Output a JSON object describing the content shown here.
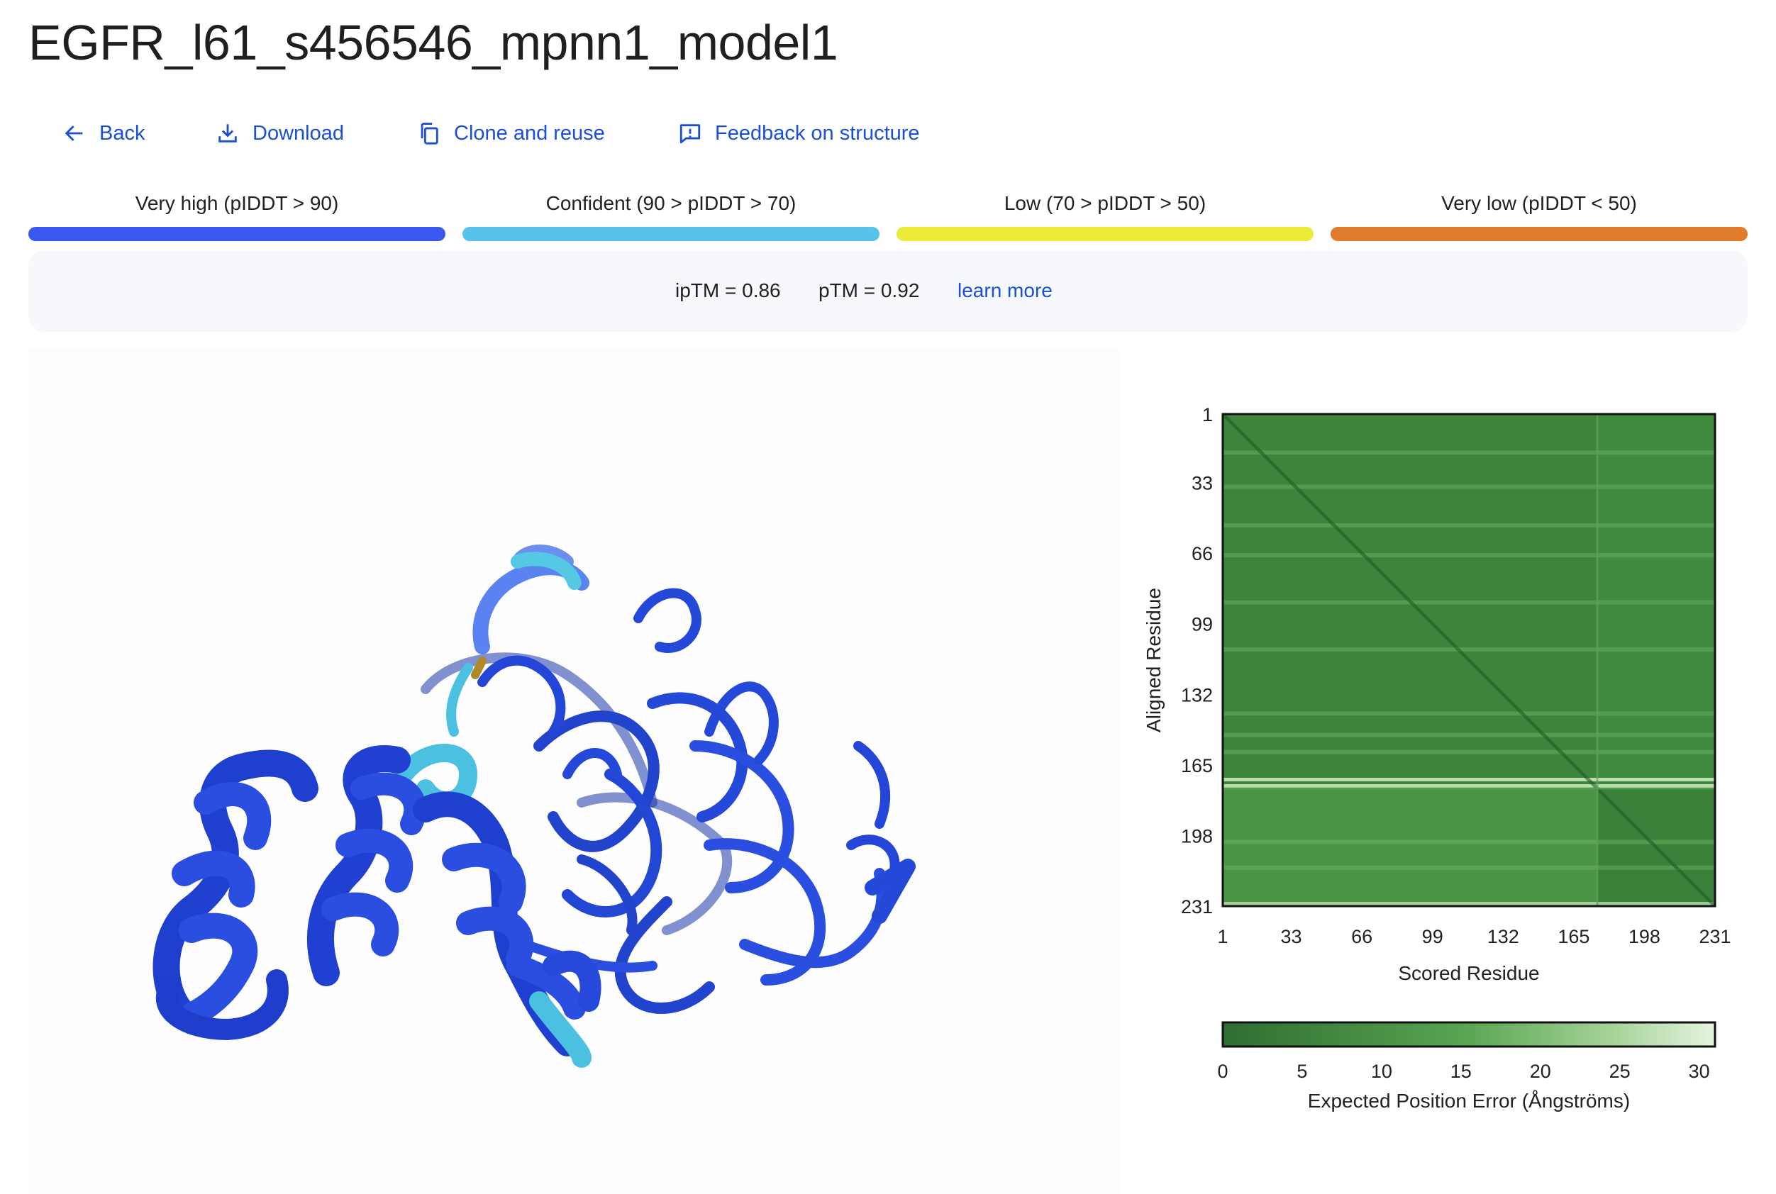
{
  "page": {
    "title": "EGFR_l61_s456546_mpnn1_model1"
  },
  "actions": {
    "back": "Back",
    "download": "Download",
    "clone": "Clone and reuse",
    "feedback": "Feedback on structure"
  },
  "legend": [
    {
      "label": "Very high (pIDDT > 90)",
      "color": "#3a57ee"
    },
    {
      "label": "Confident (90 > pIDDT > 70)",
      "color": "#57c3ea"
    },
    {
      "label": "Low (70 > pIDDT > 50)",
      "color": "#ecec38"
    },
    {
      "label": "Very low (pIDDT < 50)",
      "color": "#e07b2c"
    }
  ],
  "metrics": {
    "iptm": "ipTM = 0.86",
    "ptm": "pTM = 0.92",
    "learn_more": "learn more"
  },
  "colors": {
    "accent": "#1a4fd6",
    "structure_main": "#2346d8",
    "structure_confident": "#4cc0e0",
    "pae_low": "#2e6e30",
    "pae_high": "#e6f3df"
  },
  "chart_data": {
    "type": "heatmap",
    "xlabel": "Scored Residue",
    "ylabel": "Aligned Residue",
    "x_ticks": [
      "1",
      "33",
      "66",
      "99",
      "132",
      "165",
      "198",
      "231"
    ],
    "y_ticks": [
      "1",
      "33",
      "66",
      "99",
      "132",
      "165",
      "198",
      "231"
    ],
    "range": [
      1,
      231
    ],
    "chain_boundary": 176,
    "bright_rows": [
      171,
      174
    ],
    "colorbar": {
      "label": "Expected Position Error (Ångströms)",
      "ticks": [
        "0",
        "5",
        "10",
        "15",
        "20",
        "25",
        "30"
      ],
      "min": 0,
      "max": 31
    }
  }
}
